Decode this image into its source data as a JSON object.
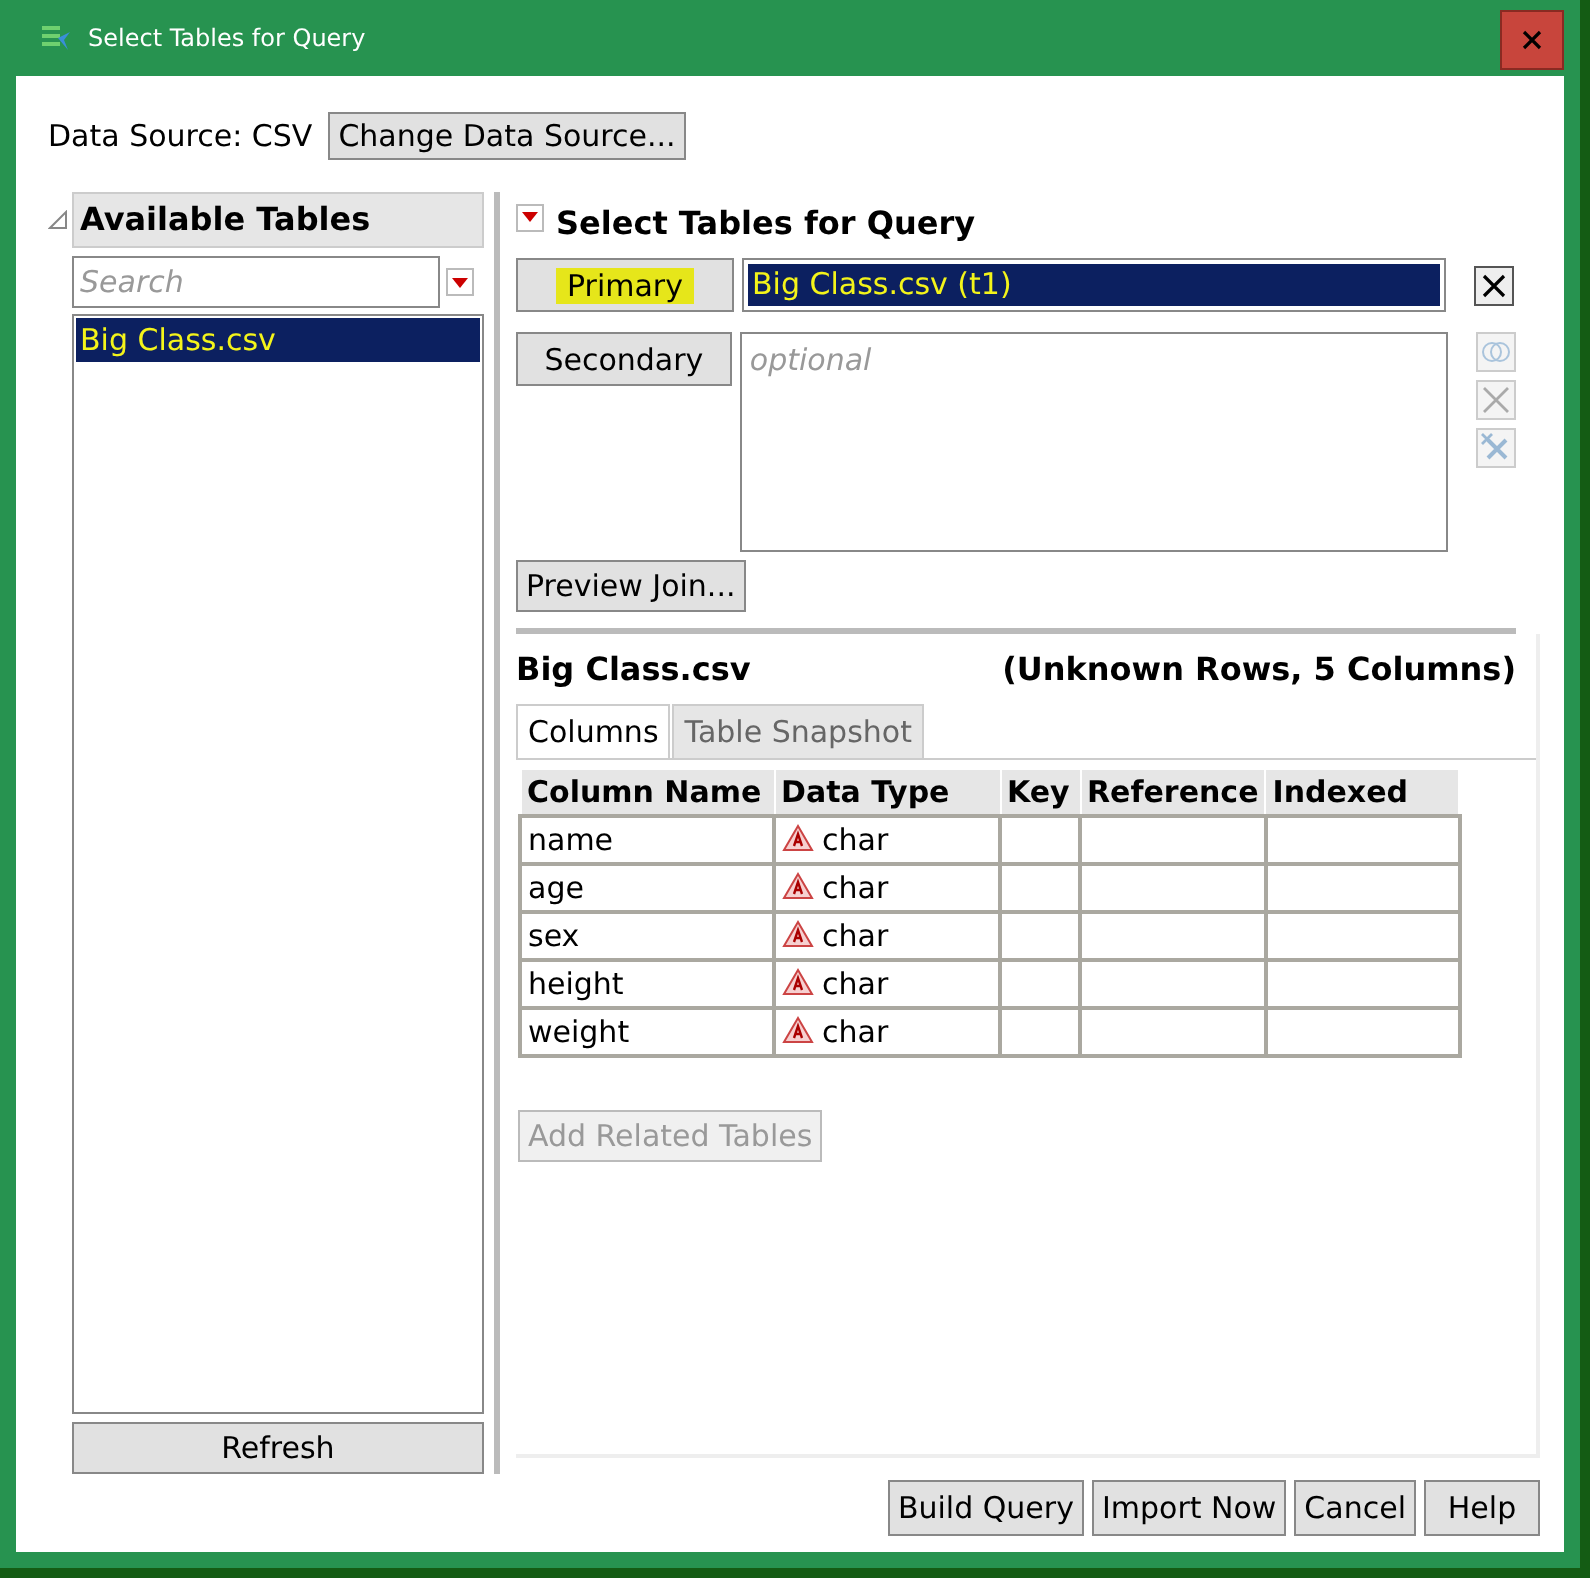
{
  "window": {
    "title": "Select Tables for Query"
  },
  "data_source": {
    "label": "Data Source: CSV",
    "button": "Change Data Source..."
  },
  "available_tables": {
    "title": "Available Tables",
    "expanded": true,
    "search": {
      "placeholder": "Search"
    },
    "items": [
      {
        "label": "Big Class.csv",
        "selected": true
      }
    ],
    "refresh": "Refresh"
  },
  "select_tables": {
    "title": "Select Tables for Query",
    "primary": {
      "button": "Primary",
      "value": "Big Class.csv (t1)"
    },
    "secondary": {
      "button": "Secondary",
      "placeholder": "optional"
    },
    "preview": "Preview Join..."
  },
  "table_info": {
    "name": "Big Class.csv",
    "summary": "(Unknown Rows, 5 Columns)",
    "tabs": [
      {
        "label": "Columns",
        "selected": true
      },
      {
        "label": "Table Snapshot",
        "selected": false
      }
    ],
    "columns": [
      "Column Name",
      "Data Type",
      "Key",
      "Reference",
      "Indexed"
    ],
    "rows": [
      {
        "name": "name",
        "type": "char"
      },
      {
        "name": "age",
        "type": "char"
      },
      {
        "name": "sex",
        "type": "char"
      },
      {
        "name": "height",
        "type": "char"
      },
      {
        "name": "weight",
        "type": "char"
      }
    ],
    "add_related": {
      "label": "Add Related Tables",
      "disabled": true
    }
  },
  "buttons": [
    {
      "label": "Build Query"
    },
    {
      "label": "Import Now"
    },
    {
      "label": "Cancel"
    },
    {
      "label": "Help"
    }
  ]
}
